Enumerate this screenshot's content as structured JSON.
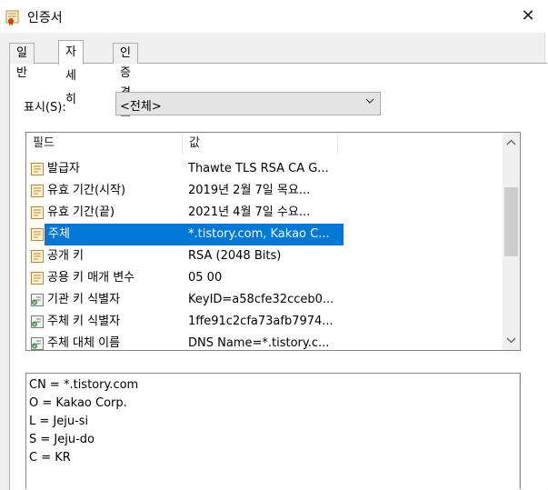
{
  "window": {
    "title": "인증서",
    "close_symbol": "✕"
  },
  "tabs": [
    {
      "label": "일반",
      "active": false
    },
    {
      "label": "자세히",
      "active": true
    },
    {
      "label": "인증 경로",
      "active": false
    }
  ],
  "show": {
    "label": "표시(S):",
    "selected": "<전체>"
  },
  "listview": {
    "columns": [
      "필드",
      "값"
    ],
    "rows": [
      {
        "field": "발급자",
        "value": "Thawte TLS RSA CA G...",
        "icon": "certificate-field-icon",
        "selected": false
      },
      {
        "field": "유효 기간(시작)",
        "value": "2019년 2월 7일 목요...",
        "icon": "certificate-field-icon",
        "selected": false
      },
      {
        "field": "유효 기간(끝)",
        "value": "2021년 4월 7일 수요...",
        "icon": "certificate-field-icon",
        "selected": false
      },
      {
        "field": "주체",
        "value": "*.tistory.com, Kakao C...",
        "icon": "certificate-field-icon",
        "selected": true
      },
      {
        "field": "공개 키",
        "value": "RSA (2048 Bits)",
        "icon": "certificate-field-icon",
        "selected": false
      },
      {
        "field": "공용 키 매개 변수",
        "value": "05 00",
        "icon": "certificate-field-icon",
        "selected": false
      },
      {
        "field": "기관 키 식별자",
        "value": "KeyID=a58cfe32cceb0...",
        "icon": "certificate-extension-icon",
        "selected": false
      },
      {
        "field": "주체 키 식별자",
        "value": "1ffe91c2cfa73afb7974...",
        "icon": "certificate-extension-icon",
        "selected": false
      },
      {
        "field": "주체 대체 이름",
        "value": "DNS Name=*.tistory.c...",
        "icon": "certificate-extension-icon",
        "selected": false
      }
    ]
  },
  "detail": {
    "lines": [
      "CN = *.tistory.com",
      "O = Kakao Corp.",
      "L = Jeju-si",
      "S = Jeju-do",
      "C = KR"
    ]
  },
  "colors": {
    "selection": "#0078d7",
    "window": "#f0f0f0",
    "border": "#adadad"
  }
}
